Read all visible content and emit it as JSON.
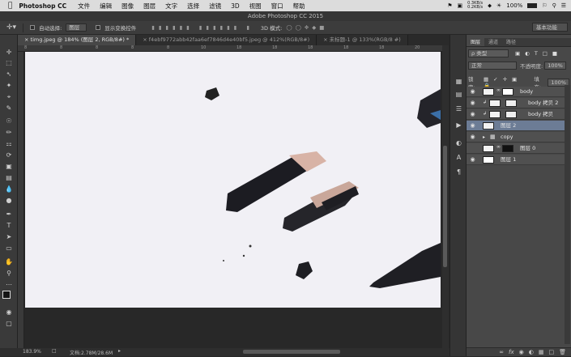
{
  "menubar": {
    "apple": "",
    "app": "Photoshop CC",
    "items": [
      "文件",
      "编辑",
      "图像",
      "图层",
      "文字",
      "选择",
      "滤镜",
      "3D",
      "视图",
      "窗口",
      "帮助"
    ],
    "netspeed_up": "0.3KB/s",
    "netspeed_down": "0.2KB/s",
    "battery": "100%",
    "status_icons": [
      "bluetooth-icon",
      "wifi-icon",
      "battery-icon",
      "flag-icon",
      "search-icon",
      "list-icon"
    ]
  },
  "window": {
    "title": "Adobe Photoshop CC 2015"
  },
  "options": {
    "auto_select_label": "自动选择:",
    "auto_select_value": "图层",
    "show_transform_label": "显示变换控件",
    "mode_3d_label": "3D 模式:",
    "workspace": "基本功能"
  },
  "tabs": [
    {
      "label": "timg.jpeg @ 184% (图层 2, RGB/8#) *",
      "active": true
    },
    {
      "label": "f4ebf9772abb42faa6ef7846d4e40bf5.jpeg @ 412%(RGB/8#)",
      "active": false
    },
    {
      "label": "未标题-1 @ 133%(RGB/8 #)",
      "active": false
    }
  ],
  "ruler_ticks": [
    "8",
    "8",
    "8",
    "8",
    "8",
    "10",
    "18",
    "18",
    "18",
    "18",
    "18",
    "20"
  ],
  "status": {
    "zoom": "183.9%",
    "doc": "文档:2.78M/28.6M"
  },
  "tools": [
    "move-tool-icon",
    "marquee-tool-icon",
    "lasso-tool-icon",
    "magic-wand-icon",
    "crop-tool-icon",
    "eyedropper-icon",
    "healing-brush-icon",
    "brush-tool-icon",
    "clone-stamp-icon",
    "history-brush-icon",
    "eraser-tool-icon",
    "gradient-tool-icon",
    "blur-tool-icon",
    "dodge-tool-icon",
    "pen-tool-icon",
    "type-tool-icon",
    "path-select-icon",
    "rectangle-tool-icon",
    "hand-tool-icon",
    "zoom-tool-icon",
    "more-tools-icon"
  ],
  "colors": {
    "foreground": "#141414",
    "background": "#ffffff",
    "selection": "#6c7c95",
    "canvas": "#f1f0f5"
  },
  "panel": {
    "tabs": [
      {
        "label": "图层",
        "active": true
      },
      {
        "label": "通道",
        "active": false
      },
      {
        "label": "路径",
        "active": false
      }
    ],
    "filter_label": "ρ 类型",
    "blend_mode": "正常",
    "opacity_label": "不透明度:",
    "opacity_value": "100%",
    "lock_label": "锁定:",
    "fill_label": "填充:",
    "fill_value": "100%",
    "layers": [
      {
        "name": "body",
        "visible": true,
        "selected": false,
        "group": false,
        "indent": 0,
        "mask": true
      },
      {
        "name": "body 拷贝 2",
        "visible": true,
        "selected": false,
        "group": false,
        "indent": 1,
        "mask": true
      },
      {
        "name": "body 拷贝",
        "visible": true,
        "selected": false,
        "group": false,
        "indent": 1,
        "mask": true
      },
      {
        "name": "图层 2",
        "visible": true,
        "selected": true,
        "group": false,
        "indent": 0,
        "mask": false
      },
      {
        "name": "copy",
        "visible": true,
        "selected": false,
        "group": true,
        "indent": 0,
        "mask": false
      },
      {
        "name": "图层 0",
        "visible": false,
        "selected": false,
        "group": false,
        "indent": 0,
        "mask": true
      },
      {
        "name": "图层 1",
        "visible": true,
        "selected": false,
        "group": false,
        "indent": 0,
        "mask": false
      }
    ],
    "bottom_icons": [
      "link-icon",
      "fx-icon",
      "mask-icon",
      "adjustment-icon",
      "folder-icon",
      "new-layer-icon",
      "trash-icon"
    ]
  }
}
